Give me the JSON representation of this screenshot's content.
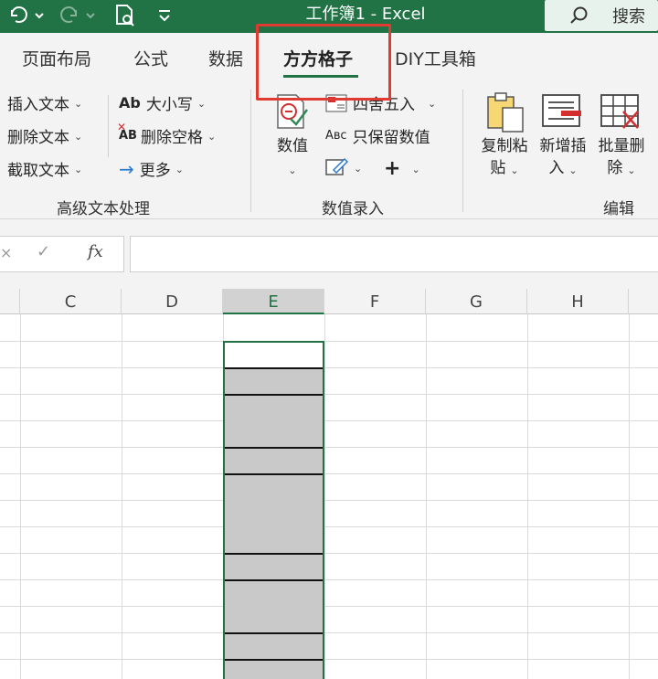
{
  "titlebar": {
    "title": "工作簿1  -  Excel",
    "search_label": "搜索",
    "bg_color": "#217346"
  },
  "tabs": [
    {
      "label": "页面布局",
      "active": false
    },
    {
      "label": "公式",
      "active": false
    },
    {
      "label": "数据",
      "active": false
    },
    {
      "label": "方方格子",
      "active": true
    },
    {
      "label": "DIY工具箱",
      "active": false
    }
  ],
  "ribbon": {
    "text_group": {
      "items": [
        "插入文本",
        "删除文本",
        "截取文本"
      ],
      "items2": [
        "大小写",
        "删除空格",
        "更多"
      ],
      "label": "高级文本处理"
    },
    "number_group": {
      "big_button": "数值",
      "items": [
        "四舍五入",
        "只保留数值"
      ],
      "label": "数值录入"
    },
    "edit_group": {
      "buttons": [
        {
          "line1": "复制粘",
          "line2": "贴"
        },
        {
          "line1": "新增插",
          "line2": "入"
        },
        {
          "line1": "批量删",
          "line2": "除"
        }
      ],
      "label": "编辑"
    }
  },
  "formula_bar": {
    "fx_label": "fx",
    "value": ""
  },
  "grid": {
    "columns": [
      "C",
      "D",
      "E",
      "F",
      "G",
      "H"
    ],
    "selected_column": "E",
    "accent_color": "#217346",
    "fill_color": "#c9c9c9"
  }
}
